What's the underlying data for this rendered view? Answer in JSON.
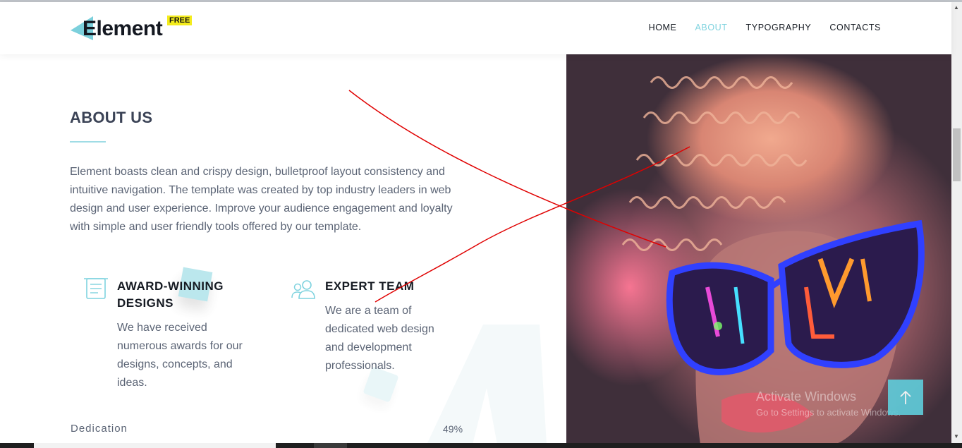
{
  "header": {
    "logo_text": "Element",
    "logo_badge": "FREE",
    "nav": [
      "HOME",
      "ABOUT",
      "TYPOGRAPHY",
      "CONTACTS"
    ],
    "active_nav": "ABOUT"
  },
  "about": {
    "title": "ABOUT US",
    "text": "Element boasts clean and crispy design, bulletproof layout consistency and intuitive navigation. The template was created by top industry leaders in web design and user experience. Improve your audience engagement and loyalty with simple and user friendly tools offered by our template."
  },
  "features": [
    {
      "icon": "document-list-icon",
      "title": "AWARD-WINNING DESIGNS",
      "text": "We have received numerous awards for our designs, concepts, and ideas."
    },
    {
      "icon": "users-icon",
      "title": "EXPERT TEAM",
      "text": "We are a team of dedicated web design and development professionals."
    }
  ],
  "skill": {
    "label": "Dedication",
    "value": "49%",
    "progress": 0.49
  },
  "watermark": {
    "line1": "Activate Windows",
    "line2": "Go to Settings to activate Windows."
  },
  "back_to_top": {
    "icon": "arrow-up-icon"
  },
  "colors": {
    "accent": "#7fd3df",
    "text": "#5b6475",
    "heading": "#3b4356",
    "badge": "#f4ec1c",
    "annotation": "#e00000"
  }
}
